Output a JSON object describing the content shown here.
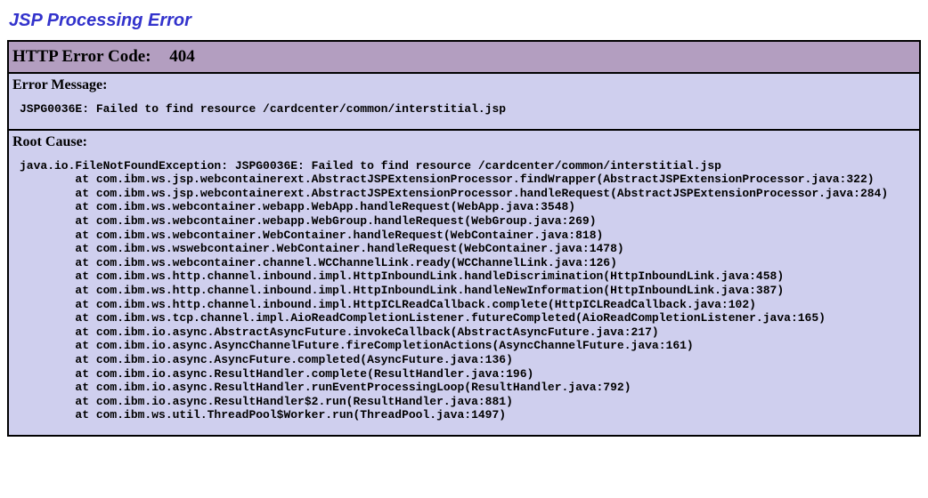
{
  "page": {
    "title": "JSP Processing Error"
  },
  "http_error": {
    "label": "HTTP Error Code:",
    "code": "404"
  },
  "error_message": {
    "heading": "Error Message:",
    "body": "JSPG0036E: Failed to find resource /cardcenter/common/interstitial.jsp"
  },
  "root_cause": {
    "heading": "Root Cause:",
    "body": "java.io.FileNotFoundException: JSPG0036E: Failed to find resource /cardcenter/common/interstitial.jsp\n        at com.ibm.ws.jsp.webcontainerext.AbstractJSPExtensionProcessor.findWrapper(AbstractJSPExtensionProcessor.java:322)\n        at com.ibm.ws.jsp.webcontainerext.AbstractJSPExtensionProcessor.handleRequest(AbstractJSPExtensionProcessor.java:284)\n        at com.ibm.ws.webcontainer.webapp.WebApp.handleRequest(WebApp.java:3548)\n        at com.ibm.ws.webcontainer.webapp.WebGroup.handleRequest(WebGroup.java:269)\n        at com.ibm.ws.webcontainer.WebContainer.handleRequest(WebContainer.java:818)\n        at com.ibm.ws.wswebcontainer.WebContainer.handleRequest(WebContainer.java:1478)\n        at com.ibm.ws.webcontainer.channel.WCChannelLink.ready(WCChannelLink.java:126)\n        at com.ibm.ws.http.channel.inbound.impl.HttpInboundLink.handleDiscrimination(HttpInboundLink.java:458)\n        at com.ibm.ws.http.channel.inbound.impl.HttpInboundLink.handleNewInformation(HttpInboundLink.java:387)\n        at com.ibm.ws.http.channel.inbound.impl.HttpICLReadCallback.complete(HttpICLReadCallback.java:102)\n        at com.ibm.ws.tcp.channel.impl.AioReadCompletionListener.futureCompleted(AioReadCompletionListener.java:165)\n        at com.ibm.io.async.AbstractAsyncFuture.invokeCallback(AbstractAsyncFuture.java:217)\n        at com.ibm.io.async.AsyncChannelFuture.fireCompletionActions(AsyncChannelFuture.java:161)\n        at com.ibm.io.async.AsyncFuture.completed(AsyncFuture.java:136)\n        at com.ibm.io.async.ResultHandler.complete(ResultHandler.java:196)\n        at com.ibm.io.async.ResultHandler.runEventProcessingLoop(ResultHandler.java:792)\n        at com.ibm.io.async.ResultHandler$2.run(ResultHandler.java:881)\n        at com.ibm.ws.util.ThreadPool$Worker.run(ThreadPool.java:1497)"
  }
}
